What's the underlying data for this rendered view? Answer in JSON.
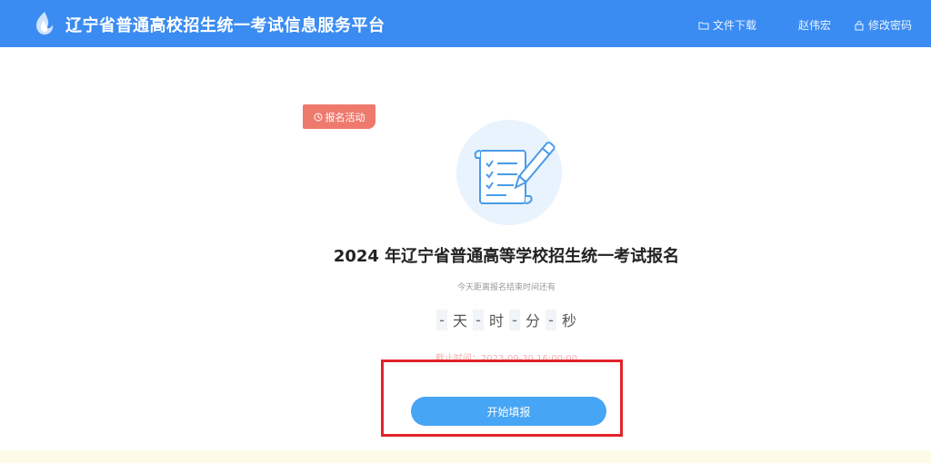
{
  "header": {
    "title": "辽宁省普通高校招生统一考试信息服务平台",
    "logo_icon": "flame-logo-icon",
    "nav": {
      "download_label": "文件下载",
      "user_name": "赵伟宏",
      "password_label": "修改密码"
    }
  },
  "main": {
    "tag_label": "报名活动",
    "exam_title": "2024 年辽宁省普通高等学校招生统一考试报名",
    "countdown_label": "今天距离报名结束时间还有",
    "countdown": {
      "days_value": "-",
      "days_unit": "天",
      "hours_value": "-",
      "hours_unit": "时",
      "minutes_value": "-",
      "minutes_unit": "分",
      "seconds_value": "-",
      "seconds_unit": "秒"
    },
    "deadline_text": "截止时间：2023-09-30 16:00:00",
    "start_button_label": "开始填报"
  },
  "colors": {
    "header_bg": "#3b8cf2",
    "tag_bg": "#ee7a6e",
    "button_bg": "#46a5f4",
    "highlight_border": "#e0242a"
  }
}
